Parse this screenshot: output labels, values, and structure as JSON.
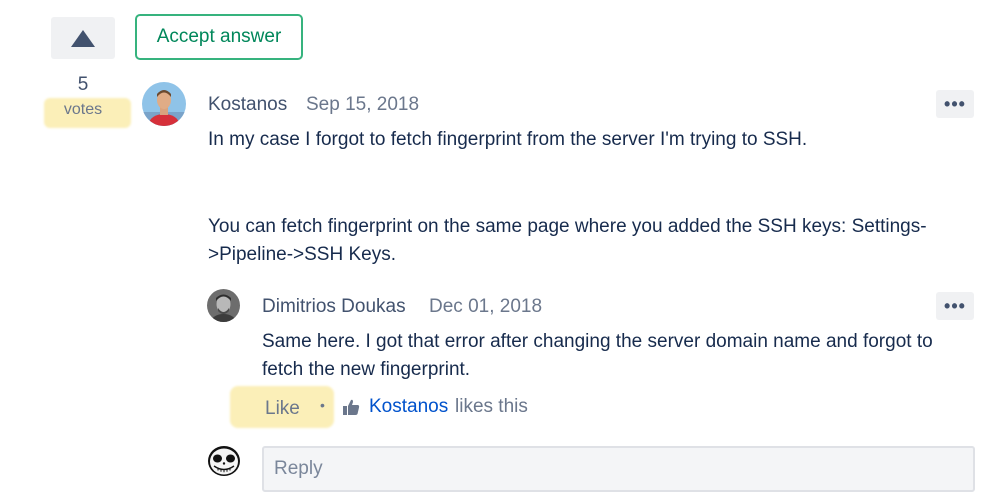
{
  "vote": {
    "count": "5",
    "label": "votes",
    "accept_label": "Accept answer"
  },
  "answer": {
    "author": "Kostanos",
    "date": "Sep 15, 2018",
    "paragraph_1": "In my case I forgot to fetch fingerprint from the server I'm trying to SSH.",
    "paragraph_2_line_1": "You can fetch fingerprint on the same page where you added the SSH keys: Settings-",
    "paragraph_2_line_2": ">Pipeline->SSH Keys.",
    "more_label": "•••"
  },
  "comment": {
    "author": "Dimitrios Doukas",
    "date": "Dec 01, 2018",
    "line_1": "Same here. I got that error after changing the server domain name and forgot to",
    "line_2": "fetch the new fingerprint.",
    "more_label": "•••",
    "like_label": "Like",
    "separator": "•",
    "liker": "Kostanos",
    "likes_suffix": "likes this"
  },
  "reply": {
    "placeholder": "Reply"
  },
  "icons": {
    "upvote": "upvote-triangle-icon",
    "thumb": "thumbs-up-icon"
  }
}
